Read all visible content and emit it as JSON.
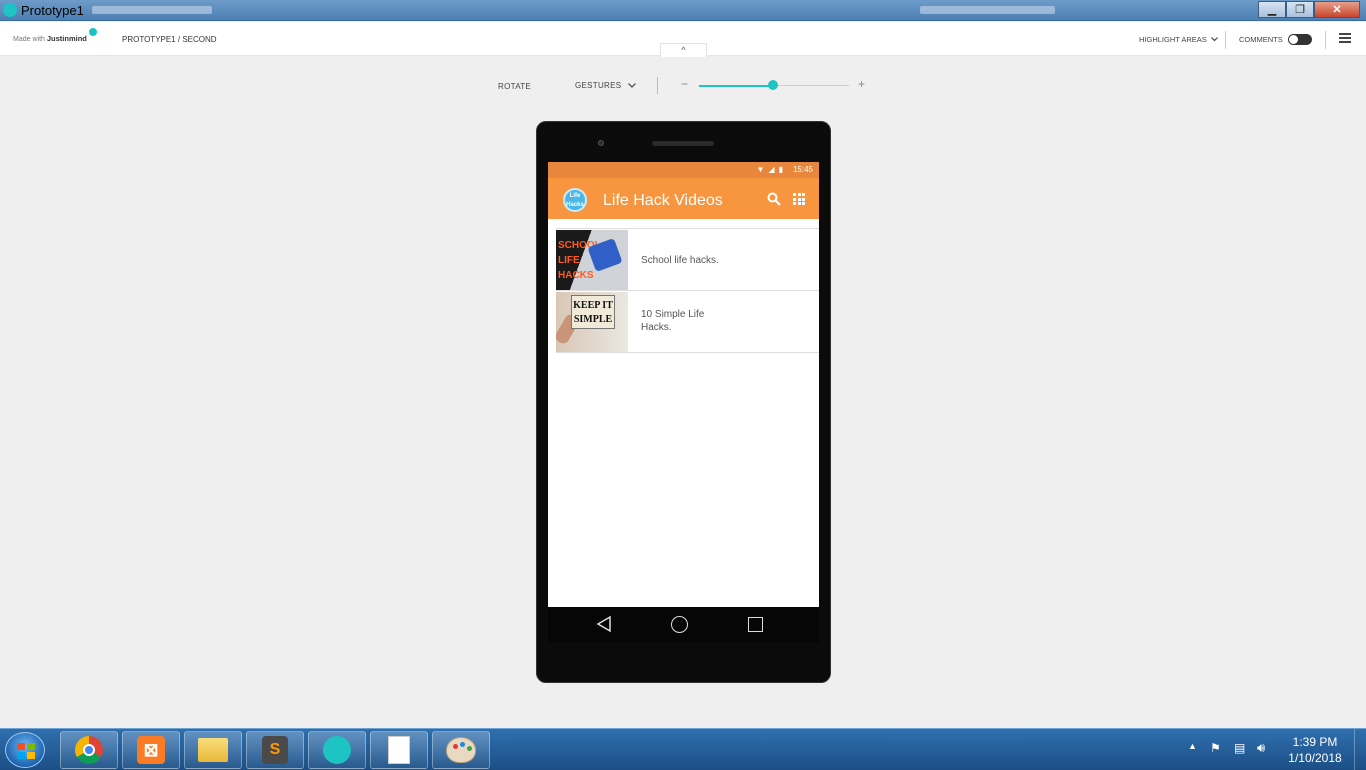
{
  "window": {
    "title": "Prototype1",
    "minimize": "▁",
    "maximize": "❐",
    "close": "✕"
  },
  "header": {
    "made_with": "Made with",
    "brand": "Justinmind",
    "breadcrumb_project": "PROTOTYPE1",
    "breadcrumb_sep": " / ",
    "breadcrumb_screen": "SECOND",
    "collapse_symbol": "^",
    "highlight_areas": "HIGHLIGHT AREAS",
    "comments": "COMMENTS"
  },
  "toolbar": {
    "rotate": "ROTATE",
    "gestures": "GESTURES",
    "zoom_minus": "−",
    "zoom_plus": "+",
    "zoom_level": 0.49
  },
  "phone": {
    "status_time": "15:45",
    "status_icons": "▼◢▮",
    "app_logo_text": "Life Hacks",
    "app_title": "Life Hack Videos",
    "videos": [
      {
        "title": "School life hacks.",
        "thumb_text": "SCHOOL LIFE HACKS"
      },
      {
        "title": "10 Simple Life Hacks.",
        "thumb_text": "KEEP IT SIMPLE"
      }
    ]
  },
  "taskbar": {
    "time": "1:39 PM",
    "date": "1/10/2018",
    "tray_arrow": "▲"
  },
  "colors": {
    "accent": "#1ec3c3",
    "statusbar": "#e8873c",
    "appbar": "#f7963f"
  }
}
